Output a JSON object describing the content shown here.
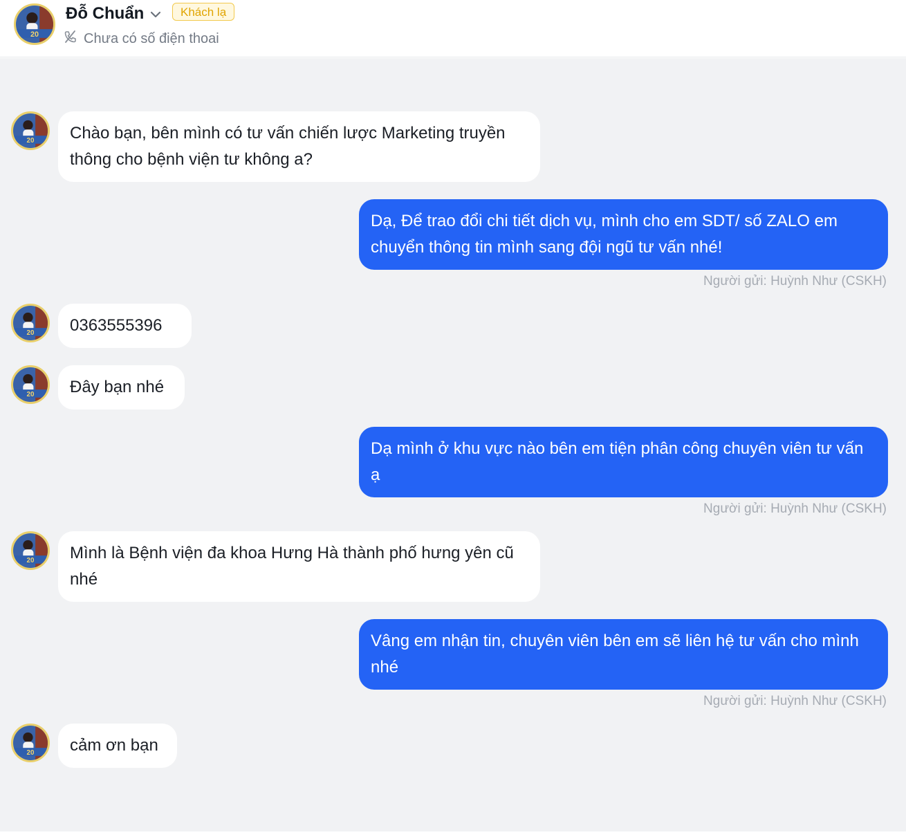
{
  "header": {
    "contact_name": "Đỗ Chuẩn",
    "badge": "Khách lạ",
    "phone_status": "Chưa có số điện thoai"
  },
  "messages": [
    {
      "direction": "in",
      "text": "Chào bạn, bên mình có tư vấn chiến lược Marketing truyền thông cho bệnh viện tư không a?"
    },
    {
      "direction": "out",
      "text": "Dạ, Để trao đổi chi tiết dịch vụ, mình cho em SDT/ số ZALO em chuyển thông tin mình sang đội ngũ tư vấn nhé!",
      "sender": "Người gửi: Huỳnh Như (CSKH)"
    },
    {
      "direction": "in",
      "text": "0363555396"
    },
    {
      "direction": "in",
      "text": "Đây bạn nhé"
    },
    {
      "direction": "out",
      "text": "Dạ mình ở khu vực nào bên em tiện phân công chuyên viên tư vấn ạ",
      "sender": "Người gửi: Huỳnh Như (CSKH)"
    },
    {
      "direction": "in",
      "text": "Mình là Bệnh viện đa khoa Hưng Hà thành phố hưng yên cũ nhé"
    },
    {
      "direction": "out",
      "text": "Vâng em nhận tin, chuyên viên bên em sẽ liên hệ tư vấn cho mình nhé",
      "sender": "Người gửi: Huỳnh Như (CSKH)"
    },
    {
      "direction": "in",
      "text": "cảm ơn bạn"
    }
  ],
  "colors": {
    "outgoing_bubble": "#2463f5",
    "incoming_bubble": "#ffffff",
    "chat_background": "#f1f2f4",
    "badge_border": "#f2c94c",
    "badge_text": "#e0a400",
    "avatar_ring": "#e9cf6a"
  },
  "icons": {
    "dropdown": "chevron-down-icon",
    "phone": "phone-slash-icon",
    "avatar": "contact-avatar"
  }
}
